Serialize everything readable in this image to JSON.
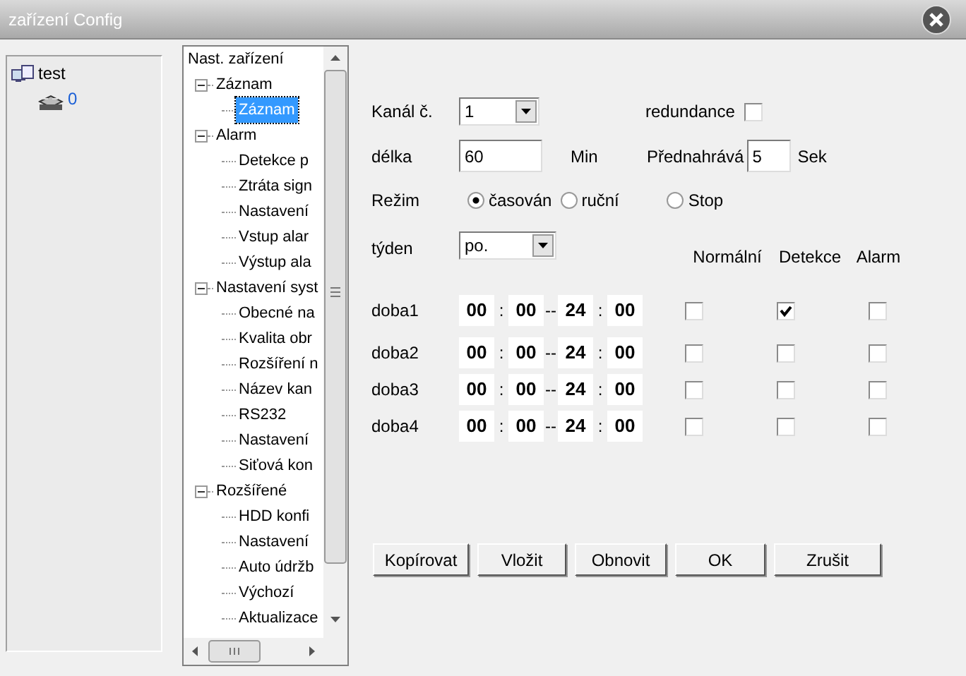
{
  "window": {
    "title": "zařízení Config"
  },
  "device_tree": {
    "label": "test",
    "children": [
      {
        "label": "0"
      }
    ]
  },
  "menu_tree": {
    "root": "Nast. zařízení",
    "groups": [
      {
        "label": "Záznam",
        "expanded": true,
        "children": [
          {
            "label": "Záznam",
            "selected": true
          }
        ]
      },
      {
        "label": "Alarm",
        "expanded": true,
        "children": [
          {
            "label": "Detekce p",
            "selected": false
          },
          {
            "label": "Ztráta sign",
            "selected": false
          },
          {
            "label": "Nastavení",
            "selected": false
          },
          {
            "label": "Vstup alar",
            "selected": false
          },
          {
            "label": "Výstup ala",
            "selected": false
          }
        ]
      },
      {
        "label": "Nastavení syst",
        "expanded": true,
        "children": [
          {
            "label": "Obecné na",
            "selected": false
          },
          {
            "label": "Kvalita obr",
            "selected": false
          },
          {
            "label": "Rozšíření n",
            "selected": false
          },
          {
            "label": "Název kan",
            "selected": false
          },
          {
            "label": "RS232",
            "selected": false
          },
          {
            "label": "Nastavení",
            "selected": false
          },
          {
            "label": "Siťová kon",
            "selected": false
          }
        ]
      },
      {
        "label": "Rozšířené",
        "expanded": true,
        "children": [
          {
            "label": "HDD konfi",
            "selected": false
          },
          {
            "label": "Nastavení",
            "selected": false
          },
          {
            "label": "Auto údržb",
            "selected": false
          },
          {
            "label": "Výchozí",
            "selected": false
          },
          {
            "label": "Aktualizace",
            "selected": false
          }
        ]
      }
    ]
  },
  "form": {
    "channel": {
      "label": "Kanál č.",
      "value": "1"
    },
    "redundancy": {
      "label": "redundance",
      "checked": false
    },
    "length": {
      "label": "délka",
      "value": "60",
      "unit": "Min"
    },
    "prerecord": {
      "label": "Přednahrává",
      "value": "5",
      "unit": "Sek"
    },
    "mode": {
      "label": "Režim",
      "options": [
        {
          "label": "časován",
          "selected": true
        },
        {
          "label": "ruční",
          "selected": false
        },
        {
          "label": "Stop",
          "selected": false
        }
      ]
    },
    "week": {
      "label": "týden",
      "value": "po."
    },
    "columns": [
      "Normální",
      "Detekce",
      "Alarm"
    ],
    "periods": [
      {
        "label": "doba1",
        "parts": [
          {
            "kind": "field",
            "text": "00"
          },
          {
            "kind": "sep",
            "text": ":"
          },
          {
            "kind": "field",
            "text": "00"
          },
          {
            "kind": "sep",
            "text": "--"
          },
          {
            "kind": "field",
            "text": "24"
          },
          {
            "kind": "sep",
            "text": ":"
          },
          {
            "kind": "field",
            "text": "00"
          }
        ],
        "checks": [
          false,
          true,
          false
        ]
      },
      {
        "label": "doba2",
        "parts": [
          {
            "kind": "field",
            "text": "00"
          },
          {
            "kind": "sep",
            "text": ":"
          },
          {
            "kind": "field",
            "text": "00"
          },
          {
            "kind": "sep",
            "text": "--"
          },
          {
            "kind": "field",
            "text": "24"
          },
          {
            "kind": "sep",
            "text": ":"
          },
          {
            "kind": "field",
            "text": "00"
          }
        ],
        "checks": [
          false,
          false,
          false
        ]
      },
      {
        "label": "doba3",
        "parts": [
          {
            "kind": "field",
            "text": "00"
          },
          {
            "kind": "sep",
            "text": ":"
          },
          {
            "kind": "field",
            "text": "00"
          },
          {
            "kind": "sep",
            "text": "--"
          },
          {
            "kind": "field",
            "text": "24"
          },
          {
            "kind": "sep",
            "text": ":"
          },
          {
            "kind": "field",
            "text": "00"
          }
        ],
        "checks": [
          false,
          false,
          false
        ]
      },
      {
        "label": "doba4",
        "parts": [
          {
            "kind": "field",
            "text": "00"
          },
          {
            "kind": "sep",
            "text": ":"
          },
          {
            "kind": "field",
            "text": "00"
          },
          {
            "kind": "sep",
            "text": "--"
          },
          {
            "kind": "field",
            "text": "24"
          },
          {
            "kind": "sep",
            "text": ":"
          },
          {
            "kind": "field",
            "text": "00"
          }
        ],
        "checks": [
          false,
          false,
          false
        ]
      }
    ]
  },
  "buttons": [
    "Kopírovat",
    "Vložit",
    "Obnovit",
    "OK",
    "Zrušit"
  ]
}
